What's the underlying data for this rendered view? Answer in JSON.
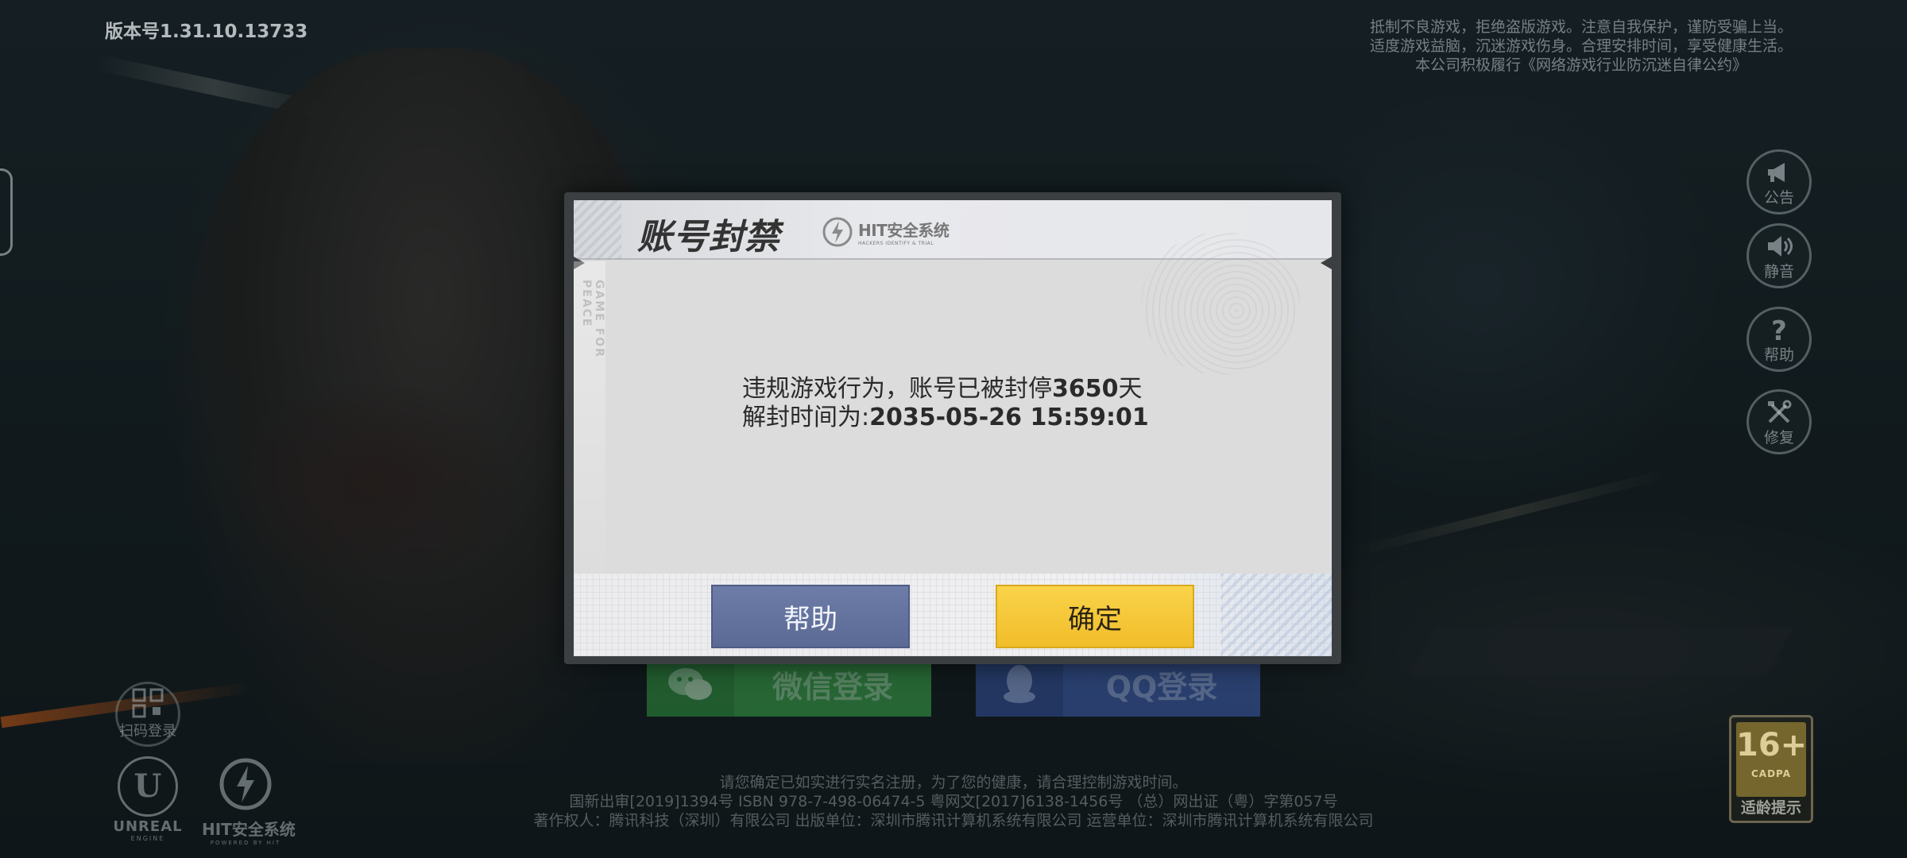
{
  "header": {
    "version": "版本号1.31.10.13733",
    "notice_lines": [
      "抵制不良游戏，拒绝盗版游戏。注意自我保护，谨防受骗上当。",
      "适度游戏益脑，沉迷游戏伤身。合理安排时间，享受健康生活。",
      "本公司积极履行《网络游戏行业防沉迷自律公约》"
    ]
  },
  "side_menu": [
    {
      "label": "公告",
      "icon": "megaphone-icon"
    },
    {
      "label": "静音",
      "icon": "speaker-icon"
    },
    {
      "label": "帮助",
      "icon": "question-icon"
    },
    {
      "label": "修复",
      "icon": "repair-tools-icon"
    }
  ],
  "bottom_left": {
    "qr_label": "扫码登录",
    "unreal_text": "UNREAL",
    "unreal_sub": "ENGINE",
    "hit_text": "HIT安全系统",
    "hit_sub": "POWERED BY HIT"
  },
  "login": {
    "wechat_label": "微信登录",
    "qq_label": "QQ登录"
  },
  "legal": {
    "line1": "请您确定已如实进行实名注册，为了您的健康，请合理控制游戏时间。",
    "line2": "国新出审[2019]1394号  ISBN 978-7-498-06474-5  粤网文[2017]6138-1456号  （总）网出证（粤）字第057号",
    "line3": "著作权人：腾讯科技（深圳）有限公司   出版单位：深圳市腾讯计算机系统有限公司   运营单位：深圳市腾讯计算机系统有限公司"
  },
  "age_rating": {
    "number": "16+",
    "org": "CADPA",
    "label": "适龄提示"
  },
  "modal": {
    "title": "账号封禁",
    "logo_text": "HIT安全系统",
    "logo_sub": "HACKERS IDENTIFY & TRIAL",
    "side_text": "GAME FOR PEACE",
    "message_line1_prefix": "违规游戏行为，账号已被封停",
    "ban_days": "3650",
    "message_line1_suffix": "天",
    "message_line2_prefix": "解封时间为:",
    "unban_time": "2035-05-26 15:59:01",
    "help_button": "帮助",
    "confirm_button": "确定"
  },
  "colors": {
    "help_button": "#5f6e98",
    "confirm_button": "#f5c83a",
    "wechat": "#3aa54a",
    "qq": "#3f5fb2"
  }
}
